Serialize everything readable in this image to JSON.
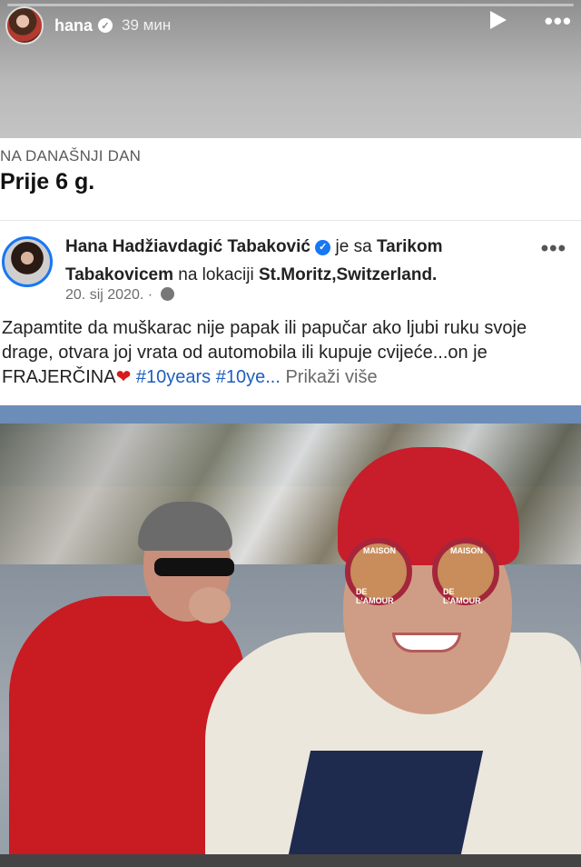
{
  "story": {
    "username": "hana",
    "time": "39 мин"
  },
  "card": {
    "memory_label": "NA DANAŠNJI DAN",
    "memory_title": "Prije 6 g.",
    "post": {
      "author": "Hana Hadžiavdagić Tabaković",
      "with_text": "je sa",
      "with_name": "Tarikom Tabakovicem",
      "location_text": "na lokaciji",
      "location": "St.Moritz,Switzerland.",
      "date": "20. sij 2020. ·",
      "text": "Zapamtite da muškarac nije papak ili papučar ako ljubi ruku svoje drage, otvara joj vrata od automobila ili kupuje cvijeće...on je FRAJERČINA",
      "hashtags": "#10years #10ye...",
      "see_more": "Prikaži više"
    },
    "photo_text": {
      "lens_top": "MAISON",
      "lens_bottom": "DE L'AMOUR"
    }
  },
  "colors": {
    "verified_blue": "#1877f2",
    "hashtag_blue": "#1f5fbf",
    "heart_red": "#d71a1a"
  },
  "icons": [
    "verified-icon",
    "play-icon",
    "more-icon",
    "globe-icon",
    "heart-icon"
  ]
}
